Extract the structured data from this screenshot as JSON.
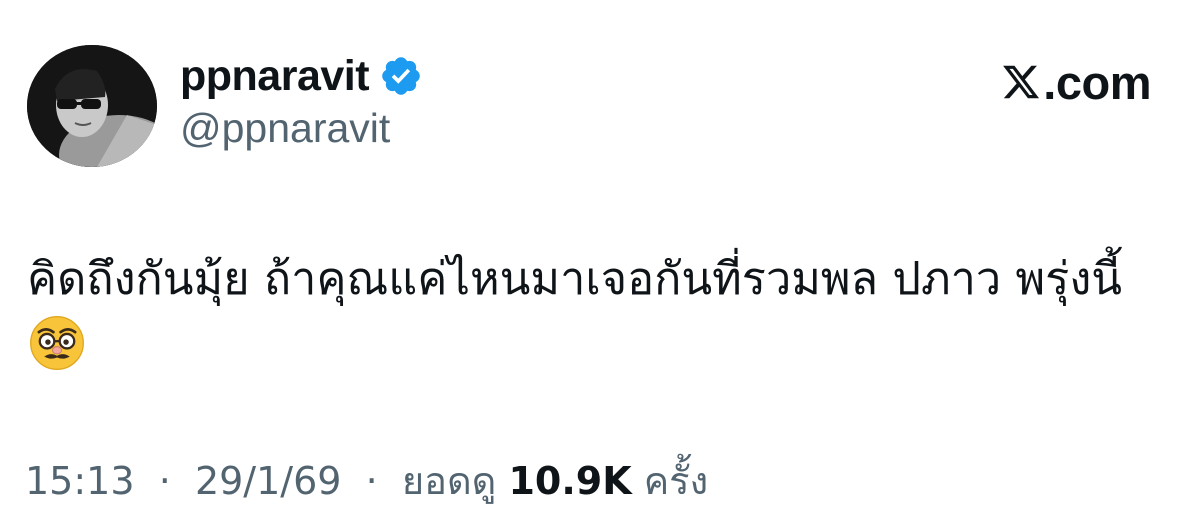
{
  "author": {
    "display_name": "ppnaravit",
    "handle": "@ppnaravit",
    "verified_icon": "verified-badge-icon",
    "avatar_icon": "profile-avatar"
  },
  "brand": {
    "logo_icon": "x-logo-icon",
    "domain_suffix": ".com"
  },
  "tweet": {
    "text": "คิดถึงกันมุ้ย ถ้าคุณแค่ไหนมาเจอกันที่รวมพล ปภาว พรุ่งนี้",
    "emoji": "disguised-face-emoji"
  },
  "meta": {
    "time": "15:13",
    "date": "29/1/69",
    "views_label": "ยอดดู",
    "views_count": "10.9K",
    "views_suffix": "ครั้ง"
  },
  "colors": {
    "text_primary": "#0f1419",
    "text_secondary": "#536471",
    "verified_blue": "#1d9bf0",
    "background": "#ffffff"
  }
}
